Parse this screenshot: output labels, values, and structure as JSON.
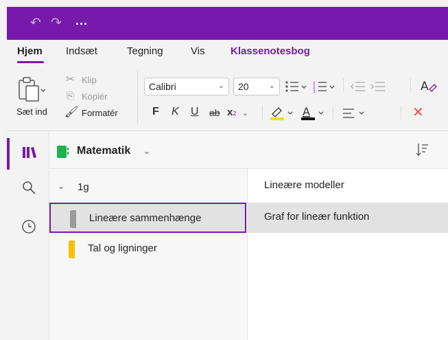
{
  "titlebar": {
    "undo_icon": "undo-icon",
    "redo_icon": "redo-icon",
    "more": "..."
  },
  "ribbon": {
    "tabs": [
      {
        "label": "Hjem"
      },
      {
        "label": "Indsæt"
      },
      {
        "label": "Tegning"
      },
      {
        "label": "Vis"
      },
      {
        "label": "Klassenotesbog"
      }
    ],
    "clipboard": {
      "paste": "Sæt ind",
      "cut": "Klip",
      "copy": "Kopiér",
      "format_painter": "Formatér"
    },
    "font": {
      "family": "Calibri",
      "size": "20"
    },
    "format": {
      "bold": "F",
      "italic": "K",
      "underline": "U",
      "strike": "ab",
      "subscript": "x"
    },
    "colors": {
      "highlight": "#f5e10a",
      "font_color": "#111111",
      "accent": "#7719aa",
      "clear": "#e05050"
    }
  },
  "notebook": {
    "title": "Matematik",
    "section_group": "1g",
    "sections": [
      {
        "label": "Lineære sammenhænge",
        "color": "#9a9a9a"
      },
      {
        "label": "Tal og ligninger",
        "color": "#f6c100"
      }
    ],
    "pages": [
      {
        "label": "Lineære modeller"
      },
      {
        "label": "Graf for lineær funktion"
      }
    ]
  }
}
